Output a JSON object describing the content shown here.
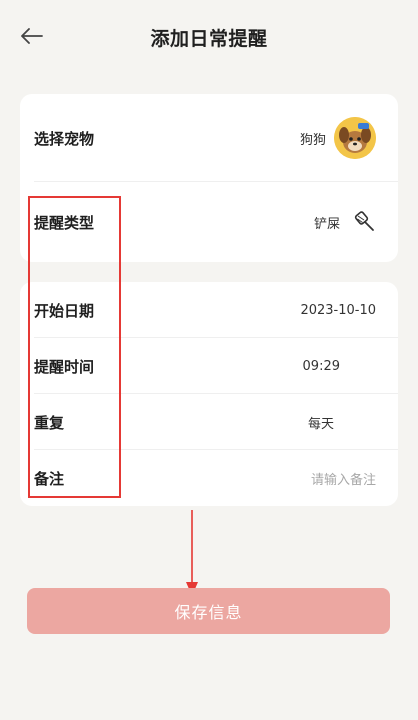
{
  "header": {
    "title": "添加日常提醒",
    "back_icon": "arrow-left-icon"
  },
  "pet_card": {
    "select_pet": {
      "label": "选择宠物",
      "value": "狗狗",
      "avatar_icon": "pet-avatar-icon"
    },
    "reminder_type": {
      "label": "提醒类型",
      "value": "铲屎",
      "icon": "scooper-icon"
    }
  },
  "schedule_card": {
    "start_date": {
      "label": "开始日期",
      "value": "2023-10-10"
    },
    "reminder_time": {
      "label": "提醒时间",
      "value": "09:29"
    },
    "repeat": {
      "label": "重复",
      "value": "每天"
    },
    "note": {
      "label": "备注",
      "placeholder": "请输入备注"
    }
  },
  "save_button": {
    "label": "保存信息"
  },
  "colors": {
    "background": "#f5f4f1",
    "card": "#ffffff",
    "save_button": "#eca7a1",
    "highlight": "#e53935"
  }
}
